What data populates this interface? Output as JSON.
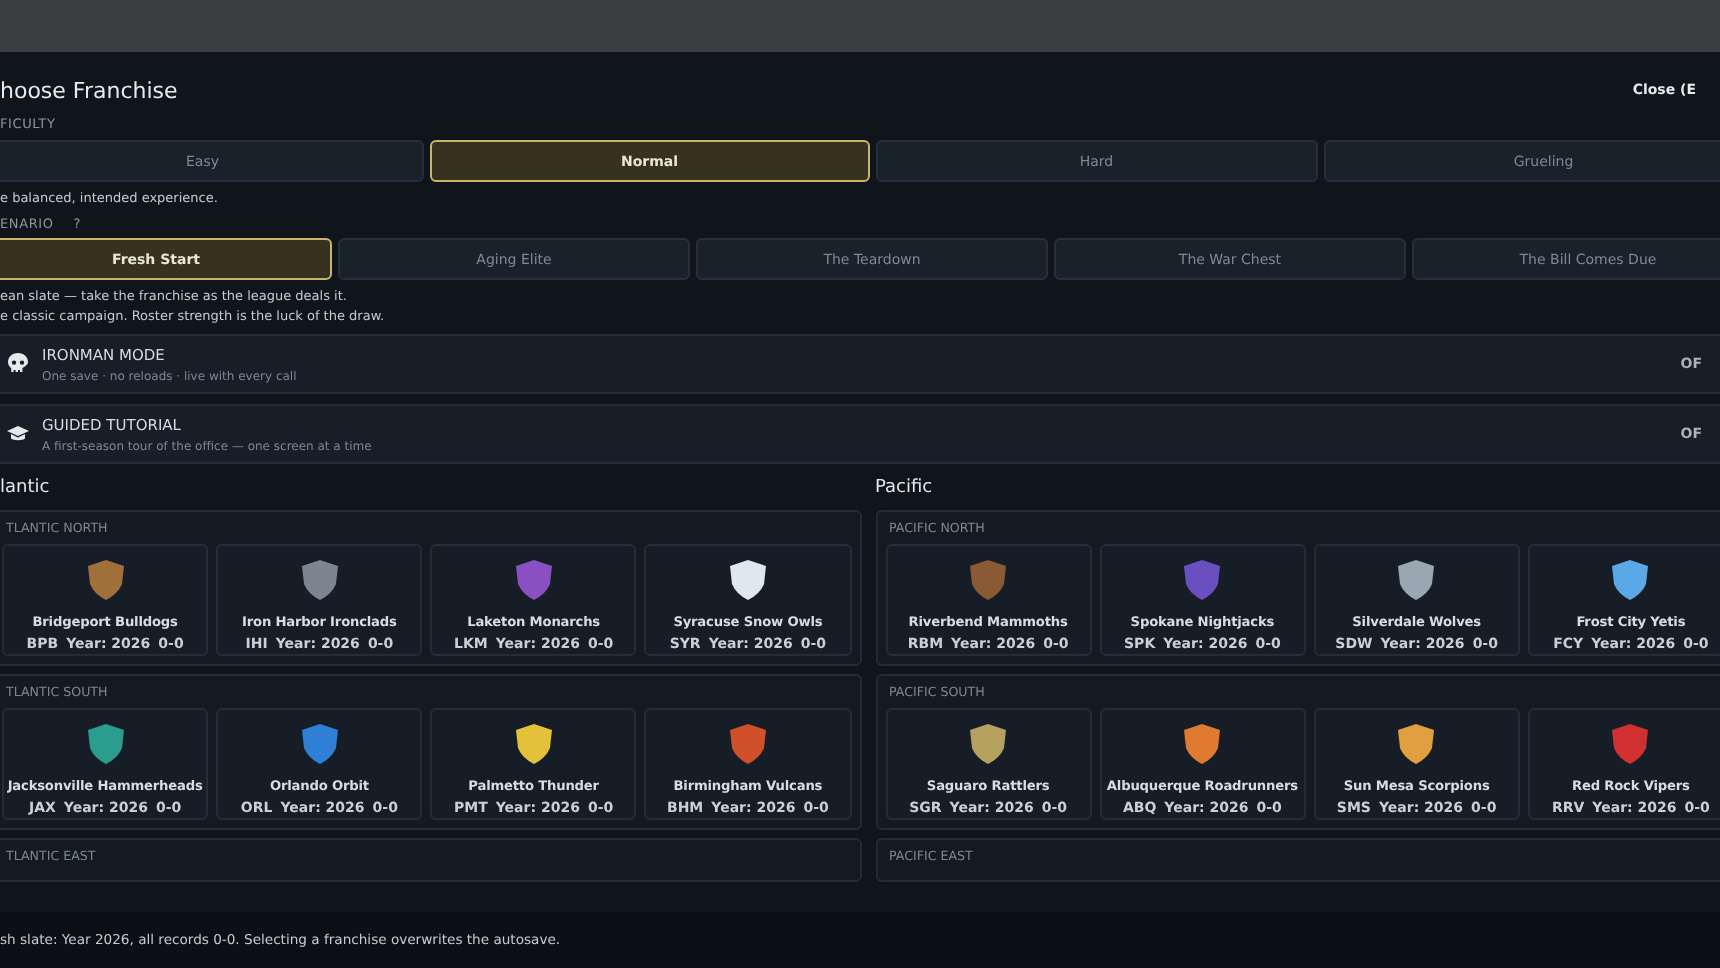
{
  "header": {
    "title": "hoose Franchise",
    "close": "Close (E"
  },
  "difficulty": {
    "label": "FICULTY",
    "options": [
      {
        "label": "Easy",
        "selected": false
      },
      {
        "label": "Normal",
        "selected": true
      },
      {
        "label": "Hard",
        "selected": false
      },
      {
        "label": "Grueling",
        "selected": false
      }
    ],
    "description": "e balanced, intended experience."
  },
  "scenario": {
    "label": "ENARIO",
    "help": "?",
    "options": [
      {
        "label": "Fresh Start",
        "selected": true
      },
      {
        "label": "Aging Elite",
        "selected": false
      },
      {
        "label": "The Teardown",
        "selected": false
      },
      {
        "label": "The War Chest",
        "selected": false
      },
      {
        "label": "The Bill Comes Due",
        "selected": false
      }
    ],
    "description": [
      "ean slate — take the franchise as the league deals it.",
      "e classic campaign. Roster strength is the luck of the draw."
    ]
  },
  "toggles": [
    {
      "kind": "skull",
      "title": "IRONMAN MODE",
      "subtitle": "One save · no reloads · live with every call",
      "value": "OF"
    },
    {
      "kind": "mortarboard",
      "title": "GUIDED TUTORIAL",
      "subtitle": "A first-season tour of the office — one screen at a time",
      "value": "OF"
    }
  ],
  "conferences": [
    {
      "name": "lantic",
      "divisions": [
        {
          "name": "TLANTIC NORTH",
          "teams": [
            {
              "name": "Bridgeport Bulldogs",
              "abbr": "BPB",
              "year": "Year: 2026",
              "record": "0-0",
              "color": "#a0703a"
            },
            {
              "name": "Iron Harbor Ironclads",
              "abbr": "IHI",
              "year": "Year: 2026",
              "record": "0-0",
              "color": "#7d8590"
            },
            {
              "name": "Laketon Monarchs",
              "abbr": "LKM",
              "year": "Year: 2026",
              "record": "0-0",
              "color": "#8a4fc0"
            },
            {
              "name": "Syracuse Snow Owls",
              "abbr": "SYR",
              "year": "Year: 2026",
              "record": "0-0",
              "color": "#dfe8f0"
            }
          ]
        },
        {
          "name": "TLANTIC SOUTH",
          "teams": [
            {
              "name": "Jacksonville Hammerheads",
              "abbr": "JAX",
              "year": "Year: 2026",
              "record": "0-0",
              "color": "#2a9d8f"
            },
            {
              "name": "Orlando Orbit",
              "abbr": "ORL",
              "year": "Year: 2026",
              "record": "0-0",
              "color": "#2f7fd6"
            },
            {
              "name": "Palmetto Thunder",
              "abbr": "PMT",
              "year": "Year: 2026",
              "record": "0-0",
              "color": "#e3c23a"
            },
            {
              "name": "Birmingham Vulcans",
              "abbr": "BHM",
              "year": "Year: 2026",
              "record": "0-0",
              "color": "#d0502a"
            }
          ]
        },
        {
          "name": "TLANTIC EAST"
        }
      ]
    },
    {
      "name": "Pacific",
      "divisions": [
        {
          "name": "PACIFIC NORTH",
          "teams": [
            {
              "name": "Riverbend Mammoths",
              "abbr": "RBM",
              "year": "Year: 2026",
              "record": "0-0",
              "color": "#8a5a34"
            },
            {
              "name": "Spokane Nightjacks",
              "abbr": "SPK",
              "year": "Year: 2026",
              "record": "0-0",
              "color": "#6a4fc0"
            },
            {
              "name": "Silverdale Wolves",
              "abbr": "SDW",
              "year": "Year: 2026",
              "record": "0-0",
              "color": "#9aa6b2"
            },
            {
              "name": "Frost City Yetis",
              "abbr": "FCY",
              "year": "Year: 2026",
              "record": "0-0",
              "color": "#5aa9e6"
            }
          ]
        },
        {
          "name": "PACIFIC SOUTH",
          "teams": [
            {
              "name": "Saguaro Rattlers",
              "abbr": "SGR",
              "year": "Year: 2026",
              "record": "0-0",
              "color": "#b5a060"
            },
            {
              "name": "Albuquerque Roadrunners",
              "abbr": "ABQ",
              "year": "Year: 2026",
              "record": "0-0",
              "color": "#e07a30"
            },
            {
              "name": "Sun Mesa Scorpions",
              "abbr": "SMS",
              "year": "Year: 2026",
              "record": "0-0",
              "color": "#e0a040"
            },
            {
              "name": "Red Rock Vipers",
              "abbr": "RRV",
              "year": "Year: 2026",
              "record": "0-0",
              "color": "#d03030"
            }
          ]
        },
        {
          "name": "PACIFIC EAST"
        }
      ]
    }
  ],
  "footer": "sh slate: Year 2026, all records 0-0. Selecting a franchise overwrites the autosave."
}
